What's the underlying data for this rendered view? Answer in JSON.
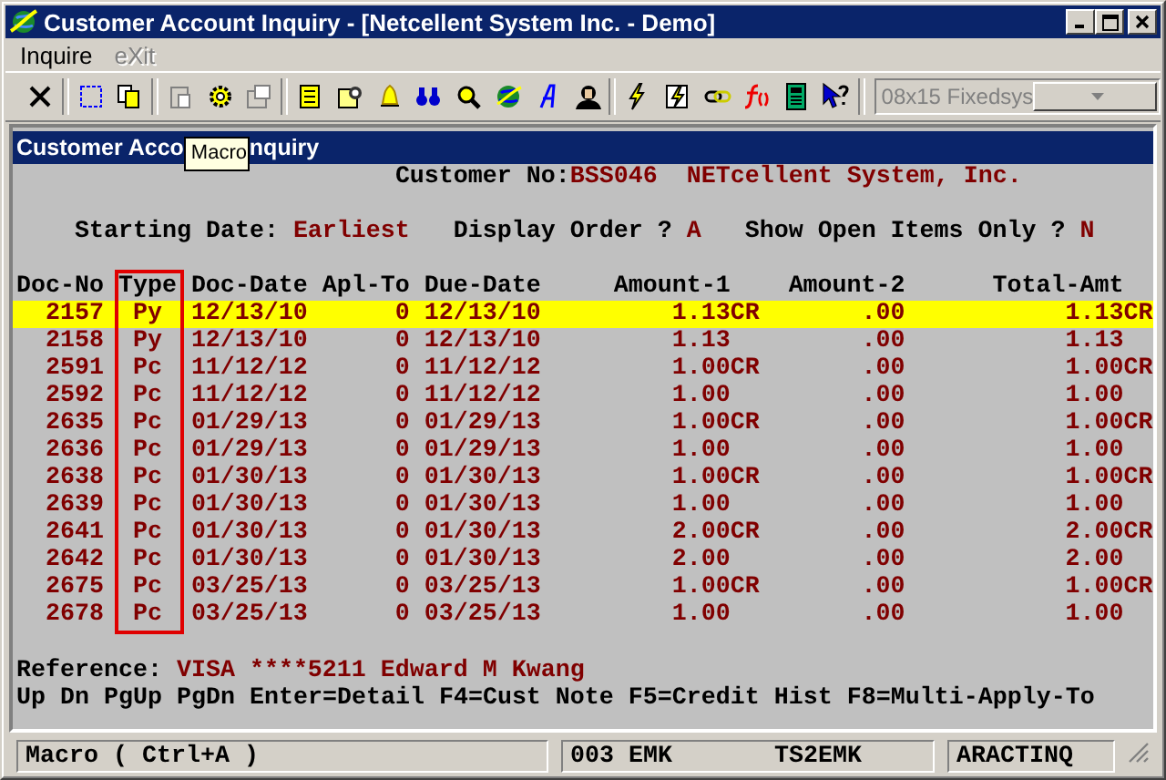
{
  "window": {
    "title": "Customer Account Inquiry - [Netcellent System Inc. - Demo]"
  },
  "menu": [
    {
      "label": "Inquire",
      "disabled": false
    },
    {
      "label": "eXit",
      "disabled": true
    }
  ],
  "toolbar": {
    "font_box": {
      "value": "08x15 Fixedsys",
      "disabled": true
    }
  },
  "screen": {
    "title_parts": [
      "Customer Acco",
      "nquiry"
    ],
    "tooltip": "Macro",
    "customer": {
      "label": "Customer No:",
      "number": "BSS046",
      "name": "NETcellent System, Inc."
    },
    "options": [
      {
        "label": "Starting Date:",
        "value": "Earliest"
      },
      {
        "label": "Display Order ?",
        "value": "A"
      },
      {
        "label": "Show Open Items Only ?",
        "value": "N"
      }
    ],
    "table": {
      "columns": [
        {
          "label": "Doc-No",
          "framed": false
        },
        {
          "label": "Type",
          "framed": true
        },
        {
          "label": "Doc-Date",
          "framed": false
        },
        {
          "label": "Apl-To",
          "framed": false
        },
        {
          "label": "Due-Date",
          "framed": false
        },
        {
          "label": "Amount-1",
          "framed": false
        },
        {
          "label": "Amount-2",
          "framed": false
        },
        {
          "label": "Total-Amt",
          "framed": false
        }
      ],
      "rows": [
        {
          "selected": true,
          "cells": [
            "2157",
            "Py",
            "12/13/10",
            "0",
            "12/13/10",
            "1.13CR",
            ".00",
            "1.13CR"
          ]
        },
        {
          "selected": false,
          "cells": [
            "2158",
            "Py",
            "12/13/10",
            "0",
            "12/13/10",
            "1.13",
            ".00",
            "1.13"
          ]
        },
        {
          "selected": false,
          "cells": [
            "2591",
            "Pc",
            "11/12/12",
            "0",
            "11/12/12",
            "1.00CR",
            ".00",
            "1.00CR"
          ]
        },
        {
          "selected": false,
          "cells": [
            "2592",
            "Pc",
            "11/12/12",
            "0",
            "11/12/12",
            "1.00",
            ".00",
            "1.00"
          ]
        },
        {
          "selected": false,
          "cells": [
            "2635",
            "Pc",
            "01/29/13",
            "0",
            "01/29/13",
            "1.00CR",
            ".00",
            "1.00CR"
          ]
        },
        {
          "selected": false,
          "cells": [
            "2636",
            "Pc",
            "01/29/13",
            "0",
            "01/29/13",
            "1.00",
            ".00",
            "1.00"
          ]
        },
        {
          "selected": false,
          "cells": [
            "2638",
            "Pc",
            "01/30/13",
            "0",
            "01/30/13",
            "1.00CR",
            ".00",
            "1.00CR"
          ]
        },
        {
          "selected": false,
          "cells": [
            "2639",
            "Pc",
            "01/30/13",
            "0",
            "01/30/13",
            "1.00",
            ".00",
            "1.00"
          ]
        },
        {
          "selected": false,
          "cells": [
            "2641",
            "Pc",
            "01/30/13",
            "0",
            "01/30/13",
            "2.00CR",
            ".00",
            "2.00CR"
          ]
        },
        {
          "selected": false,
          "cells": [
            "2642",
            "Pc",
            "01/30/13",
            "0",
            "01/30/13",
            "2.00",
            ".00",
            "2.00"
          ]
        },
        {
          "selected": false,
          "cells": [
            "2675",
            "Pc",
            "03/25/13",
            "0",
            "03/25/13",
            "1.00CR",
            ".00",
            "1.00CR"
          ]
        },
        {
          "selected": false,
          "cells": [
            "2678",
            "Pc",
            "03/25/13",
            "0",
            "03/25/13",
            "1.00",
            ".00",
            "1.00"
          ]
        }
      ]
    },
    "reference": {
      "label": "Reference:",
      "value": "VISA ****5211 Edward M Kwang"
    },
    "keys": "Up Dn PgUp PgDn Enter=Detail F4=Cust Note F5=Credit Hist F8=Multi-Apply-To"
  },
  "status_bar": [
    {
      "texts": [
        "Macro ( Ctrl+A )"
      ]
    },
    {
      "texts": [
        "003 EMK",
        "TS2EMK"
      ]
    },
    {
      "texts": [
        "ARACTINQ"
      ]
    }
  ]
}
